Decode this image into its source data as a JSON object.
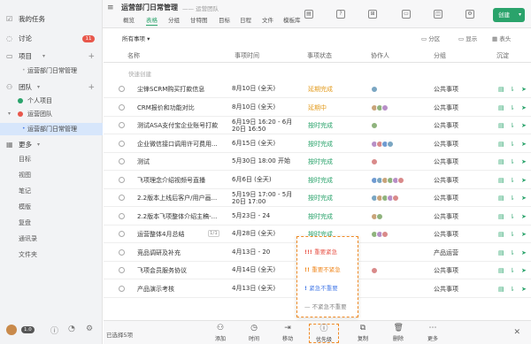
{
  "sidebar": {
    "my_tasks": "我的任务",
    "discuss": "讨论",
    "discuss_badge": "11",
    "projects": "项目",
    "project_item": "运营部门日常管理",
    "teams": "团队",
    "personal_project": "个人项目",
    "ops_team": "运营团队",
    "team_project": "运营部门日常管理",
    "more": "更多",
    "more_items": [
      "目标",
      "视图",
      "笔记",
      "模版",
      "复盘",
      "通讯录",
      "文件夹"
    ],
    "user_badge": "1.0"
  },
  "header": {
    "title": "运营部门日常管理",
    "subtitle": "—— 运营团队",
    "tabs": [
      "概览",
      "表格",
      "分组",
      "甘特图",
      "目标",
      "日程",
      "文件",
      "模板库"
    ],
    "active_tab": "表格",
    "create_button": "创建"
  },
  "filter": {
    "all_items": "所有事项",
    "group": "分区",
    "display": "显示",
    "table_head": "表头"
  },
  "columns": [
    "名称",
    "事项时间",
    "事项状态",
    "协作人",
    "分组",
    "沉淀"
  ],
  "quick_create": "快速创建",
  "rows": [
    {
      "name": "尘锋SCRM购买打款信息",
      "time": "8月10日 (全天)",
      "status": "延期完成",
      "group": "公共事项"
    },
    {
      "name": "CRM报价和功能对比",
      "time": "8月10日 (全天)",
      "status": "延期中",
      "group": "公共事项"
    },
    {
      "name": "测试ASA支付宝企业账号打款",
      "time": "6月19日 16:20 - 6月20日 16:50",
      "status": "按时完成",
      "group": "公共事项"
    },
    {
      "name": "企业微信接口调用许可费用...",
      "time": "6月15日 (全天)",
      "status": "按时完成",
      "group": "公共事项"
    },
    {
      "name": "测试",
      "time": "5月30日 18:00 开始",
      "status": "按时完成",
      "group": "公共事项"
    },
    {
      "name": "飞项理念介绍视频号直播",
      "time": "6月6日 (全天)",
      "status": "按时完成",
      "group": "公共事项"
    },
    {
      "name": "2.2版本上线后客户/用户画...",
      "time": "5月19日 17:00 - 5月20日 17:00",
      "status": "按时完成",
      "group": "公共事项"
    },
    {
      "name": "2.2版本飞项整体介绍主稿-...",
      "time": "5月23日 - 24",
      "status": "按时完成",
      "group": "公共事项"
    },
    {
      "name": "运营整体4月总结",
      "time": "4月28日 (全天)",
      "status": "按时完成",
      "group": "公共事项"
    },
    {
      "name": "竞品调研及补充",
      "time": "4月13日 - 20",
      "status": "按时完成",
      "group": "产品运营"
    },
    {
      "name": "飞项会员服务协议",
      "time": "4月14日 (全天)",
      "status": "按时完成",
      "group": "公共事项"
    },
    {
      "name": "产品演示考核",
      "time": "4月13日 (全天)",
      "status": "按时完成",
      "group": "公共事项"
    }
  ],
  "row8_tag": "1/1",
  "bottom": {
    "selected": "已选择5项",
    "actions": [
      "添加",
      "时间",
      "移动",
      "优先级",
      "复制",
      "删除",
      "更多"
    ]
  },
  "priority_menu": {
    "items": [
      {
        "label": "重要紧急",
        "color": "#e8574b"
      },
      {
        "label": "重要不紧急",
        "color": "#f08a24"
      },
      {
        "label": "紧急不重要",
        "color": "#4a7ee8"
      },
      {
        "label": "不紧急不重要",
        "color": "#888888"
      }
    ]
  },
  "colors": {
    "accent": "#2aa36b",
    "late": "#e39b1d",
    "badge": "#e8574b"
  }
}
